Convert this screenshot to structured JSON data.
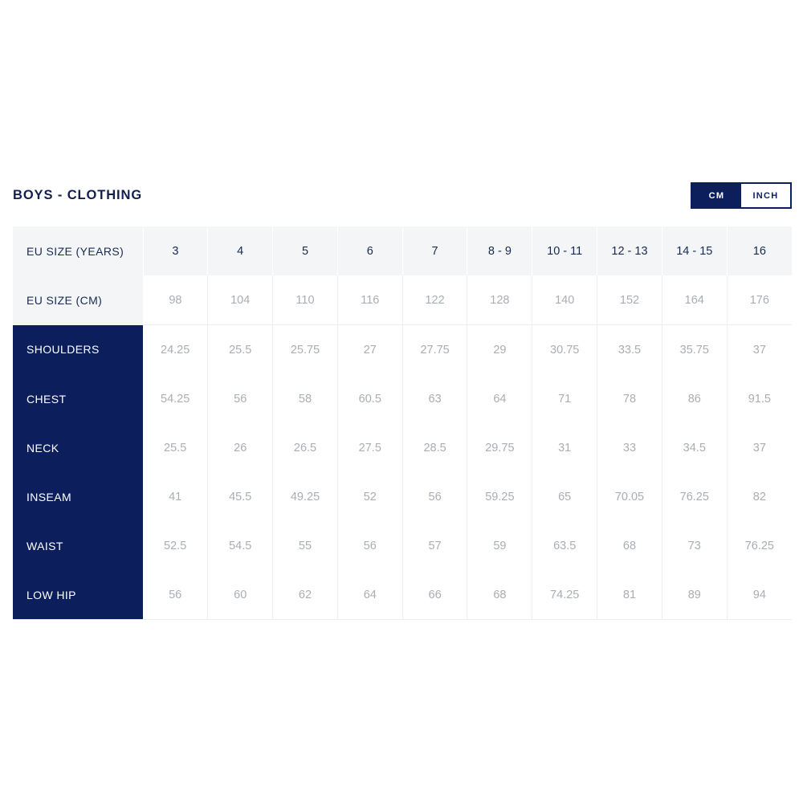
{
  "page": {
    "title": "BOYS - CLOTHING",
    "background": "#ffffff",
    "accent_navy": "#0c1f5c",
    "header_grey": "#f4f5f7",
    "value_text_grey": "#a9adb4"
  },
  "unit_toggle": {
    "active_unit": "CM",
    "options": [
      {
        "label": "CM",
        "active": true
      },
      {
        "label": "INCH",
        "active": false
      }
    ]
  },
  "chart_data": {
    "type": "table",
    "title": "BOYS - CLOTHING",
    "unit": "CM",
    "header_rows": [
      {
        "label": "EU SIZE (YEARS)",
        "values": [
          "3",
          "4",
          "5",
          "6",
          "7",
          "8 - 9",
          "10 - 11",
          "12 - 13",
          "14 - 15",
          "16"
        ]
      },
      {
        "label": "EU SIZE (CM)",
        "values": [
          "98",
          "104",
          "110",
          "116",
          "122",
          "128",
          "140",
          "152",
          "164",
          "176"
        ]
      }
    ],
    "categories": [
      "3",
      "4",
      "5",
      "6",
      "7",
      "8 - 9",
      "10 - 11",
      "12 - 13",
      "14 - 15",
      "16"
    ],
    "series": [
      {
        "name": "SHOULDERS",
        "values": [
          "24.25",
          "25.5",
          "25.75",
          "27",
          "27.75",
          "29",
          "30.75",
          "33.5",
          "35.75",
          "37"
        ]
      },
      {
        "name": "CHEST",
        "values": [
          "54.25",
          "56",
          "58",
          "60.5",
          "63",
          "64",
          "71",
          "78",
          "86",
          "91.5"
        ]
      },
      {
        "name": "NECK",
        "values": [
          "25.5",
          "26",
          "26.5",
          "27.5",
          "28.5",
          "29.75",
          "31",
          "33",
          "34.5",
          "37"
        ]
      },
      {
        "name": "INSEAM",
        "values": [
          "41",
          "45.5",
          "49.25",
          "52",
          "56",
          "59.25",
          "65",
          "70.05",
          "76.25",
          "82"
        ]
      },
      {
        "name": "WAIST",
        "values": [
          "52.5",
          "54.5",
          "55",
          "56",
          "57",
          "59",
          "63.5",
          "68",
          "73",
          "76.25"
        ]
      },
      {
        "name": "LOW HIP",
        "values": [
          "56",
          "60",
          "62",
          "64",
          "66",
          "68",
          "74.25",
          "81",
          "89",
          "94"
        ]
      }
    ]
  }
}
